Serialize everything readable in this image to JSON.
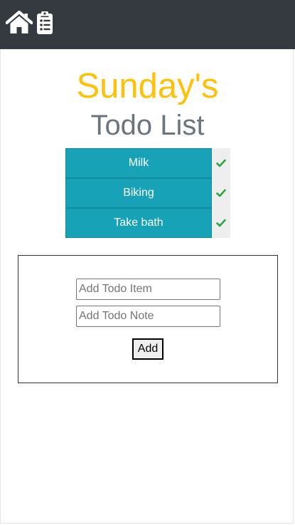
{
  "navbar": {
    "home_icon": "home-icon",
    "list_icon": "clipboard-list-icon",
    "background": "#343a40"
  },
  "header": {
    "day_title": "Sunday's",
    "list_title": "Todo List",
    "day_color": "#ffc107",
    "list_color": "#6c757d"
  },
  "todos": [
    {
      "label": "Milk",
      "done_icon": "check-icon"
    },
    {
      "label": "Biking",
      "done_icon": "check-icon"
    },
    {
      "label": "Take bath",
      "done_icon": "check-icon"
    }
  ],
  "form": {
    "item_placeholder": "Add Todo Item",
    "note_placeholder": "Add Todo Note",
    "item_value": "",
    "note_value": "",
    "add_label": "Add"
  },
  "colors": {
    "todo_bg": "#17a2b8",
    "check": "#28a745"
  }
}
